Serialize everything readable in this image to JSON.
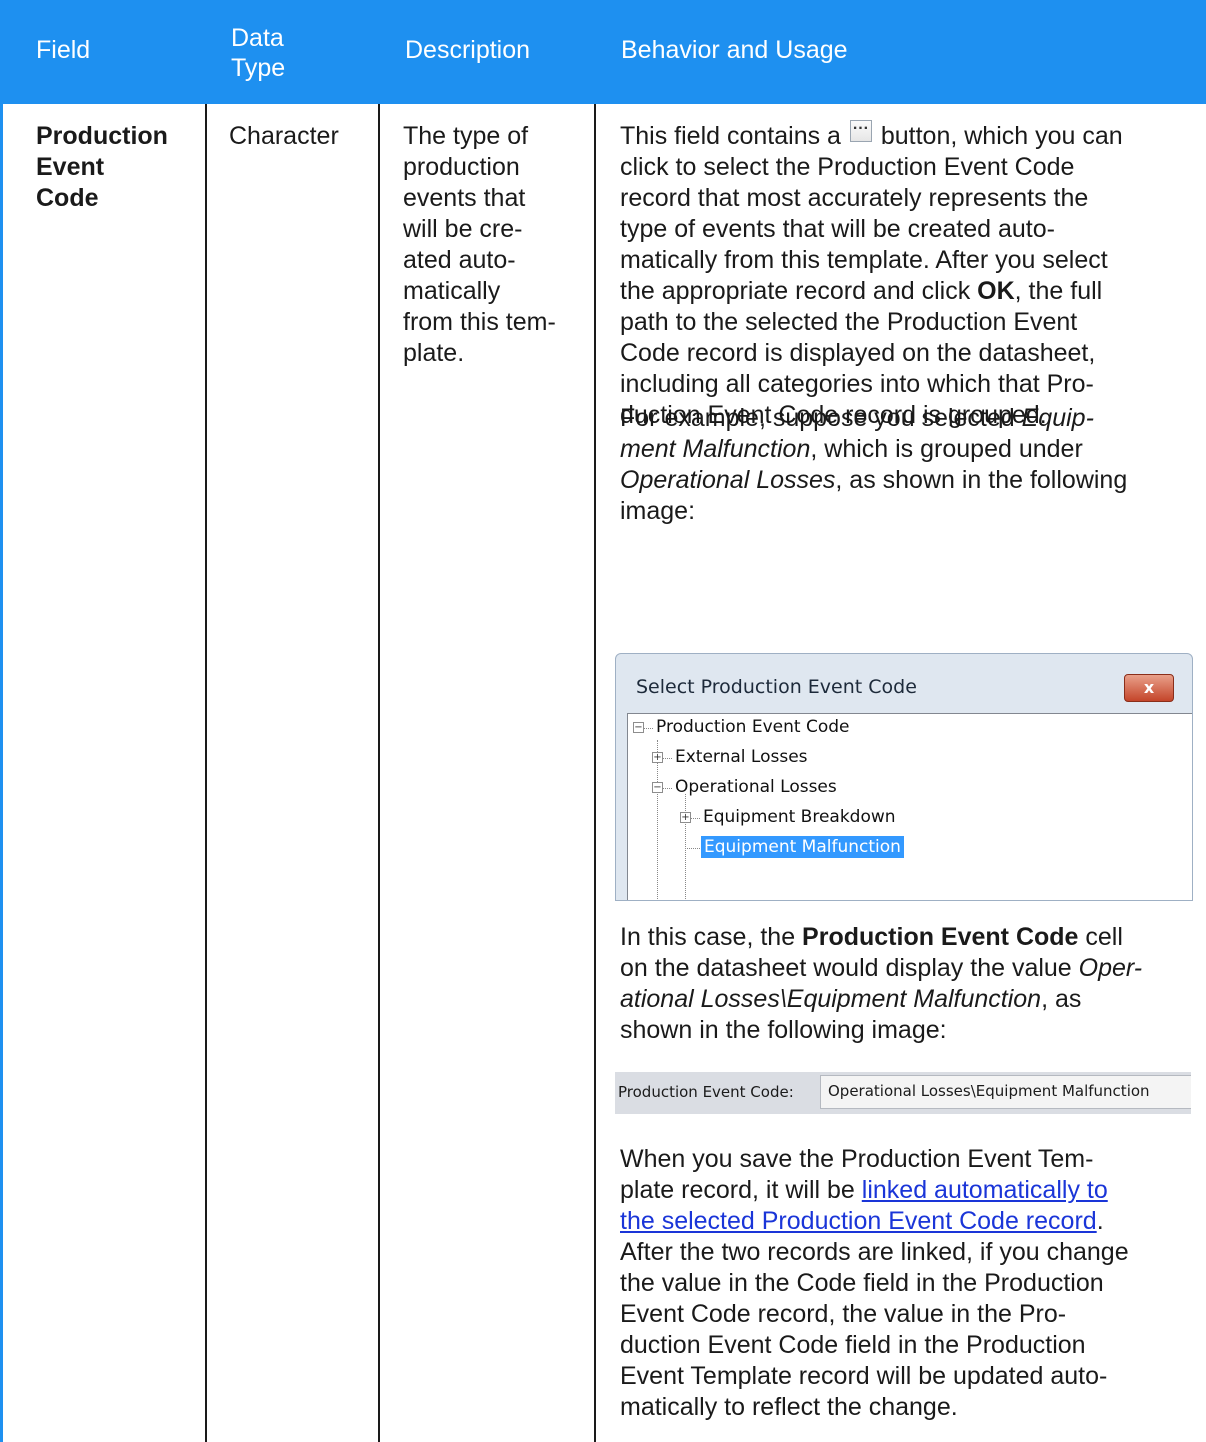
{
  "table": {
    "headers": {
      "field": "Field",
      "data_type_line1": "Data",
      "data_type_line2": "Type",
      "description": "Description",
      "behavior": "Behavior and Usage"
    },
    "row": {
      "field_lines": [
        "Production",
        "Event",
        "Code"
      ],
      "data_type": "Character",
      "description_lines": [
        "The type of",
        "production",
        "events that",
        "will be cre-",
        "ated auto-",
        "matically",
        "from this tem-",
        "plate."
      ],
      "behavior": {
        "p1_first_a": "This field contains a",
        "p1_first_b": "button, which you can",
        "p1_lines": [
          "click to select the Production Event Code",
          "record that most accurately represents the",
          "type of events that will be created auto-",
          "matically from this template. After you select"
        ],
        "p1_line5_a": "the appropriate record and click ",
        "p1_line5_b": "OK",
        "p1_line5_c": ", the full",
        "p1_lines_end": [
          "path to the selected the Production Event",
          "Code record is displayed on the datasheet,",
          "including all categories into which that Pro-",
          "duction Event Code record is grouped."
        ],
        "p2_l1_a": "For example, suppose you selected ",
        "p2_l1_b": "Equip-",
        "p2_l2_a": "ment Malfunction",
        "p2_l2_b": ", which is grouped under",
        "p2_l3_a": "Operational Losses",
        "p2_l3_b": ", as shown in the following",
        "p2_l4": "image:",
        "p3_l1_a": "In this case, the ",
        "p3_l1_b": "Production Event Code",
        "p3_l1_c": " cell",
        "p3_l2_a": "on the datasheet would display the value ",
        "p3_l2_b": "Oper-",
        "p3_l3_a": "ational Losses\\Equipment Malfunction",
        "p3_l3_b": ", as",
        "p3_l4": "shown in the following image:",
        "p4_l1": "When you save the Production Event Tem-",
        "p4_l2_a": "plate record, it will be ",
        "p4_link_1": "linked automatically to",
        "p4_link_2": "the selected Production Event Code record",
        "p4_l3_end": ".",
        "p4_lines": [
          "After the two records are linked, if you change",
          "the value in the Code field in the Production",
          "Event Code record, the value in the Pro-",
          "duction Event Code field in the Production",
          "Event Template record will be updated auto-",
          "matically to reflect the change."
        ]
      }
    }
  },
  "dialog": {
    "title": "Select Production Event Code",
    "close_icon": "x",
    "tree": {
      "root": "Production Event Code",
      "external": "External Losses",
      "operational": "Operational Losses",
      "breakdown": "Equipment Breakdown",
      "malfunction": "Equipment Malfunction"
    }
  },
  "field_strip": {
    "label": "Production Event Code:",
    "value": "Operational Losses\\Equipment Malfunction"
  },
  "colors": {
    "header_bg": "#1e90f0",
    "link": "#1a35d8",
    "selection": "#3399ff"
  }
}
